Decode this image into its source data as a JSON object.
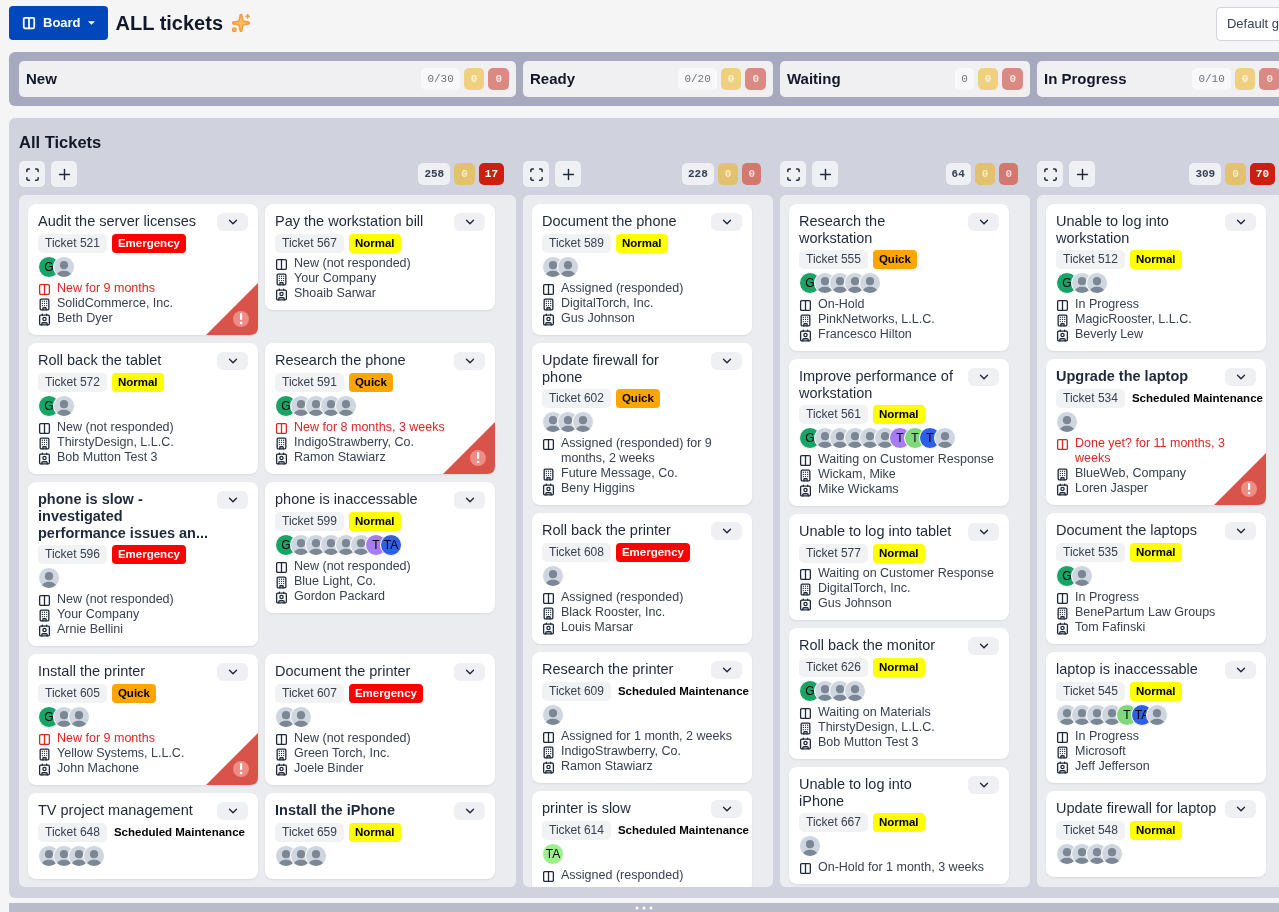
{
  "header": {
    "view_button": "Board",
    "title": "ALL tickets",
    "filter_button": "Default g"
  },
  "lanes": [
    {
      "name": "New",
      "limit": "0/30",
      "yellow": "0",
      "red": "0"
    },
    {
      "name": "Ready",
      "limit": "0/20",
      "yellow": "0",
      "red": "0"
    },
    {
      "name": "Waiting",
      "limit": "0",
      "yellow": "0",
      "red": "0"
    },
    {
      "name": "In Progress",
      "limit": "0/10",
      "yellow": "0",
      "red": "0"
    }
  ],
  "board": {
    "title": "All Tickets",
    "columns": [
      {
        "kind": "double",
        "count": "258",
        "yellow": "0",
        "red": "17",
        "red_active": true,
        "cards": [
          {
            "title": "Audit the server licenses",
            "bold": false,
            "ticket": "Ticket 521",
            "priority": {
              "label": "Emergency",
              "kind": "emergency"
            },
            "avatars": [
              {
                "kind": "initials",
                "text": "G",
                "color": "#18a367"
              },
              {
                "kind": "photo"
              }
            ],
            "status": {
              "text": "New for 9 months",
              "overdue": true
            },
            "company": "SolidCommerce, Inc.",
            "contact": "Beth Dyer",
            "alert": true
          },
          {
            "title": "Pay the workstation bill",
            "bold": false,
            "ticket": "Ticket 567",
            "priority": {
              "label": "Normal",
              "kind": "normal"
            },
            "status": {
              "text": "New (not responded)",
              "overdue": false
            },
            "company": "Your Company",
            "contact": "Shoaib Sarwar",
            "alert": false
          },
          {
            "title": "Roll back the tablet",
            "bold": false,
            "ticket": "Ticket 572",
            "priority": {
              "label": "Normal",
              "kind": "normal"
            },
            "avatars": [
              {
                "kind": "initials",
                "text": "G",
                "color": "#18a367"
              },
              {
                "kind": "photo"
              }
            ],
            "status": {
              "text": "New (not responded)",
              "overdue": false
            },
            "company": "ThirstyDesign, L.L.C.",
            "contact": "Bob Mutton Test 3",
            "alert": false
          },
          {
            "title": "Research the phone",
            "bold": false,
            "ticket": "Ticket 591",
            "priority": {
              "label": "Quick",
              "kind": "quick"
            },
            "avatars": [
              {
                "kind": "initials",
                "text": "G",
                "color": "#18a367"
              },
              {
                "kind": "photo"
              },
              {
                "kind": "photo"
              },
              {
                "kind": "photo"
              },
              {
                "kind": "photo"
              }
            ],
            "status": {
              "text": "New for 8 months, 3 weeks",
              "overdue": true
            },
            "company": "IndigoStrawberry, Co.",
            "contact": "Ramon Stawiarz",
            "alert": true
          },
          {
            "title": "phone is slow - investigated performance issues an...",
            "bold": true,
            "ticket": "Ticket 596",
            "priority": {
              "label": "Emergency",
              "kind": "emergency"
            },
            "avatars": [
              {
                "kind": "photo"
              }
            ],
            "status": {
              "text": "New (not responded)",
              "overdue": false
            },
            "company": "Your Company",
            "contact": "Arnie Bellini",
            "alert": false
          },
          {
            "title": "phone is inaccessable",
            "bold": false,
            "ticket": "Ticket 599",
            "priority": {
              "label": "Normal",
              "kind": "normal"
            },
            "avatars": [
              {
                "kind": "initials",
                "text": "G",
                "color": "#18a367"
              },
              {
                "kind": "photo"
              },
              {
                "kind": "photo"
              },
              {
                "kind": "photo"
              },
              {
                "kind": "photo"
              },
              {
                "kind": "photo"
              },
              {
                "kind": "initials",
                "text": "T",
                "color": "#a67cf2"
              },
              {
                "kind": "initials",
                "text": "TA",
                "color": "#2f5fe6"
              }
            ],
            "status": {
              "text": "New (not responded)",
              "overdue": false
            },
            "company": "Blue Light, Co.",
            "contact": "Gordon Packard",
            "alert": false
          },
          {
            "title": "Install the printer",
            "bold": false,
            "ticket": "Ticket 605",
            "priority": {
              "label": "Quick",
              "kind": "quick"
            },
            "avatars": [
              {
                "kind": "initials",
                "text": "G",
                "color": "#18a367"
              },
              {
                "kind": "photo"
              },
              {
                "kind": "photo"
              }
            ],
            "status": {
              "text": "New for 9 months",
              "overdue": true
            },
            "company": "Yellow Systems, L.L.C.",
            "contact": "John Machone",
            "alert": true
          },
          {
            "title": "Document the printer",
            "bold": false,
            "ticket": "Ticket 607",
            "priority": {
              "label": "Emergency",
              "kind": "emergency"
            },
            "avatars": [
              {
                "kind": "photo"
              },
              {
                "kind": "photo"
              }
            ],
            "status": {
              "text": "New (not responded)",
              "overdue": false
            },
            "company": "Green Torch, Inc.",
            "contact": "Joele Binder",
            "alert": false
          },
          {
            "title": "TV project management",
            "bold": false,
            "ticket": "Ticket 648",
            "priority": {
              "label": "Scheduled Maintenance",
              "kind": "scheduled"
            },
            "avatars": [
              {
                "kind": "photo"
              },
              {
                "kind": "photo"
              },
              {
                "kind": "photo"
              },
              {
                "kind": "photo"
              }
            ],
            "alert": false
          },
          {
            "title": "Install the iPhone",
            "bold": true,
            "ticket": "Ticket 659",
            "priority": {
              "label": "Normal",
              "kind": "normal"
            },
            "avatars": [
              {
                "kind": "photo"
              },
              {
                "kind": "photo"
              },
              {
                "kind": "photo"
              }
            ],
            "alert": false
          }
        ]
      },
      {
        "kind": "single",
        "count": "228",
        "yellow": "0",
        "red": "0",
        "red_active": false,
        "cards": [
          {
            "title": "Document the phone",
            "bold": false,
            "ticket": "Ticket 589",
            "priority": {
              "label": "Normal",
              "kind": "normal"
            },
            "avatars": [
              {
                "kind": "photo"
              },
              {
                "kind": "photo"
              }
            ],
            "status": {
              "text": "Assigned (responded)",
              "overdue": false
            },
            "company": "DigitalTorch, Inc.",
            "contact": "Gus Johnson",
            "alert": false
          },
          {
            "title": "Update firewall for phone",
            "bold": false,
            "ticket": "Ticket 602",
            "priority": {
              "label": "Quick",
              "kind": "quick"
            },
            "avatars": [
              {
                "kind": "photo"
              },
              {
                "kind": "photo"
              },
              {
                "kind": "photo"
              }
            ],
            "status": {
              "text": "Assigned (responded) for 9 months, 2 weeks",
              "overdue": false
            },
            "company": "Future Message, Co.",
            "contact": "Beny Higgins",
            "alert": false
          },
          {
            "title": "Roll back the printer",
            "bold": false,
            "ticket": "Ticket 608",
            "priority": {
              "label": "Emergency",
              "kind": "emergency"
            },
            "avatars": [
              {
                "kind": "photo"
              }
            ],
            "status": {
              "text": "Assigned (responded)",
              "overdue": false
            },
            "company": "Black Rooster, Inc.",
            "contact": "Louis Marsar",
            "alert": false
          },
          {
            "title": "Research the printer",
            "bold": false,
            "ticket": "Ticket 609",
            "priority": {
              "label": "Scheduled Maintenance",
              "kind": "scheduled"
            },
            "avatars": [
              {
                "kind": "photo"
              }
            ],
            "status": {
              "text": "Assigned for 1 month, 2 weeks",
              "overdue": false
            },
            "company": "IndigoStrawberry, Co.",
            "contact": "Ramon Stawiarz",
            "alert": false
          },
          {
            "title": "printer is slow",
            "bold": false,
            "ticket": "Ticket 614",
            "priority": {
              "label": "Scheduled Maintenance",
              "kind": "scheduled"
            },
            "avatars": [
              {
                "kind": "initials",
                "text": "TA",
                "color": "#9cf08a"
              }
            ],
            "status": {
              "text": "Assigned (responded)",
              "overdue": false
            },
            "alert": false
          }
        ]
      },
      {
        "kind": "single",
        "count": "64",
        "yellow": "0",
        "red": "0",
        "red_active": false,
        "cards": [
          {
            "title": "Research the workstation",
            "bold": false,
            "ticket": "Ticket 555",
            "priority": {
              "label": "Quick",
              "kind": "quick"
            },
            "avatars": [
              {
                "kind": "initials",
                "text": "G",
                "color": "#18a367"
              },
              {
                "kind": "photo"
              },
              {
                "kind": "photo"
              },
              {
                "kind": "photo"
              },
              {
                "kind": "photo"
              }
            ],
            "status": {
              "text": "On-Hold",
              "overdue": false
            },
            "company": "PinkNetworks, L.L.C.",
            "contact": "Francesco Hilton",
            "alert": false
          },
          {
            "title": "Improve performance of workstation",
            "bold": false,
            "ticket": "Ticket 561",
            "priority": {
              "label": "Normal",
              "kind": "normal"
            },
            "avatars": [
              {
                "kind": "initials",
                "text": "G",
                "color": "#18a367"
              },
              {
                "kind": "photo"
              },
              {
                "kind": "photo"
              },
              {
                "kind": "photo"
              },
              {
                "kind": "photo"
              },
              {
                "kind": "photo"
              },
              {
                "kind": "initials",
                "text": "T",
                "color": "#a67cf2"
              },
              {
                "kind": "initials",
                "text": "T",
                "color": "#7fd97c"
              },
              {
                "kind": "initials",
                "text": "T",
                "color": "#2f5fe6"
              },
              {
                "kind": "photo"
              }
            ],
            "status": {
              "text": "Waiting on Customer Response",
              "overdue": false
            },
            "company": "Wickam, Mike",
            "contact": "Mike Wickams",
            "alert": false
          },
          {
            "title": "Unable to log into tablet",
            "bold": false,
            "ticket": "Ticket 577",
            "priority": {
              "label": "Normal",
              "kind": "normal"
            },
            "status": {
              "text": "Waiting on Customer Response",
              "overdue": false
            },
            "company": "DigitalTorch, Inc.",
            "contact": "Gus Johnson",
            "alert": false
          },
          {
            "title": "Roll back the monitor",
            "bold": false,
            "ticket": "Ticket 626",
            "priority": {
              "label": "Normal",
              "kind": "normal"
            },
            "avatars": [
              {
                "kind": "initials",
                "text": "G",
                "color": "#18a367"
              },
              {
                "kind": "photo"
              },
              {
                "kind": "photo"
              },
              {
                "kind": "photo"
              }
            ],
            "status": {
              "text": "Waiting on Materials",
              "overdue": false
            },
            "company": "ThirstyDesign, L.L.C.",
            "contact": "Bob Mutton Test 3",
            "alert": false
          },
          {
            "title": "Unable to log into iPhone",
            "bold": false,
            "ticket": "Ticket 667",
            "priority": {
              "label": "Normal",
              "kind": "normal"
            },
            "avatars": [
              {
                "kind": "photo"
              }
            ],
            "status": {
              "text": "On-Hold for 1 month, 3 weeks",
              "overdue": false
            },
            "alert": false
          }
        ]
      },
      {
        "kind": "single",
        "count": "309",
        "yellow": "0",
        "red": "70",
        "red_active": true,
        "cards": [
          {
            "title": "Unable to log into workstation",
            "bold": false,
            "ticket": "Ticket 512",
            "priority": {
              "label": "Normal",
              "kind": "normal"
            },
            "avatars": [
              {
                "kind": "initials",
                "text": "G",
                "color": "#18a367"
              },
              {
                "kind": "photo"
              },
              {
                "kind": "photo"
              }
            ],
            "status": {
              "text": "In Progress",
              "overdue": false
            },
            "company": "MagicRooster, L.L.C.",
            "contact": "Beverly Lew",
            "alert": false
          },
          {
            "title": "Upgrade the laptop",
            "bold": true,
            "ticket": "Ticket 534",
            "priority": {
              "label": "Scheduled Maintenance",
              "kind": "scheduled"
            },
            "avatars": [
              {
                "kind": "photo"
              }
            ],
            "status": {
              "text": "Done yet? for 11 months, 3 weeks",
              "overdue": true
            },
            "company": "BlueWeb, Company",
            "contact": "Loren Jasper",
            "alert": true
          },
          {
            "title": "Document the laptops",
            "bold": false,
            "ticket": "Ticket 535",
            "priority": {
              "label": "Normal",
              "kind": "normal"
            },
            "avatars": [
              {
                "kind": "initials",
                "text": "G",
                "color": "#18a367"
              },
              {
                "kind": "photo"
              }
            ],
            "status": {
              "text": "In Progress",
              "overdue": false
            },
            "company": "BenePartum Law Groups",
            "contact": "Tom Fafinski",
            "alert": false
          },
          {
            "title": "laptop is inaccessable",
            "bold": false,
            "ticket": "Ticket 545",
            "priority": {
              "label": "Normal",
              "kind": "normal"
            },
            "avatars": [
              {
                "kind": "photo"
              },
              {
                "kind": "photo"
              },
              {
                "kind": "photo"
              },
              {
                "kind": "photo"
              },
              {
                "kind": "initials",
                "text": "T",
                "color": "#7fd97c"
              },
              {
                "kind": "initials",
                "text": "TA",
                "color": "#2f5fe6"
              },
              {
                "kind": "photo"
              }
            ],
            "status": {
              "text": "In Progress",
              "overdue": false
            },
            "company": "Microsoft",
            "contact": "Jeff Jefferson",
            "alert": false
          },
          {
            "title": "Update firewall for laptop",
            "bold": false,
            "ticket": "Ticket 548",
            "priority": {
              "label": "Normal",
              "kind": "normal"
            },
            "avatars": [
              {
                "kind": "photo"
              },
              {
                "kind": "photo"
              },
              {
                "kind": "photo"
              },
              {
                "kind": "photo"
              }
            ],
            "alert": false
          }
        ]
      }
    ]
  }
}
